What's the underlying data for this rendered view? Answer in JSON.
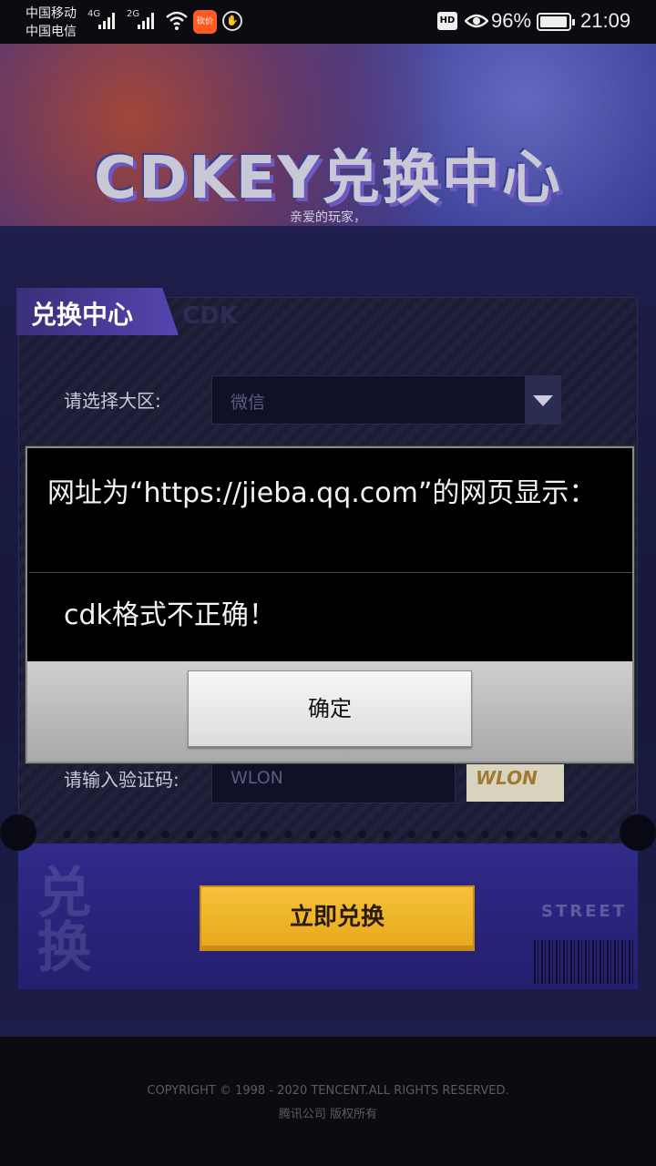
{
  "status_bar": {
    "carrier1": "中国移动",
    "carrier2": "中国电信",
    "net1": "4G",
    "net2": "2G",
    "app_icon": "砍价",
    "hd": "HD",
    "battery_percent": "96%",
    "battery_level": 0.96,
    "time": "21:09"
  },
  "hero": {
    "title": "CDKEY兑换中心",
    "subtitle": "亲爱的玩家，"
  },
  "panel": {
    "tab": "兑换中心",
    "tab_ghost": "CDK",
    "region_label": "请选择大区:",
    "region_value": "微信",
    "captcha_label": "请输入验证码:",
    "captcha_value": "WLON",
    "captcha_image_text": "WLON",
    "redeem_button": "立即兑换",
    "deco_text": "兑换",
    "street": "STREET"
  },
  "footer": {
    "copyright": "COPYRIGHT © 1998 - 2020 TENCENT.ALL RIGHTS RESERVED.",
    "company": "腾讯公司 版权所有"
  },
  "dialog": {
    "title": "网址为“https://jieba.qq.com”的网页显示：",
    "message": "cdk格式不正确！",
    "ok_label": "确定"
  }
}
